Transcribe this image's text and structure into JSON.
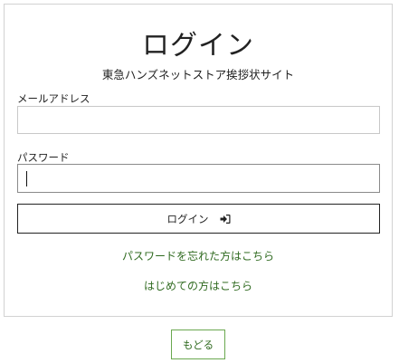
{
  "login_card": {
    "title": "ログイン",
    "subtitle": "東急ハンズネットストア挨拶状サイト",
    "email_label": "メールアドレス",
    "email_value": "",
    "password_label": "パスワード",
    "password_value": "",
    "login_button_label": "ログイン",
    "login_button_icon": "sign-in-icon",
    "forgot_password_link": "パスワードを忘れた方はこちら",
    "first_time_link": "はじめての方はこちら"
  },
  "back_button_label": "もどる",
  "colors": {
    "link_green": "#2f6a1f",
    "back_border_green": "#6aa84f",
    "card_border": "#d2d2d2"
  }
}
